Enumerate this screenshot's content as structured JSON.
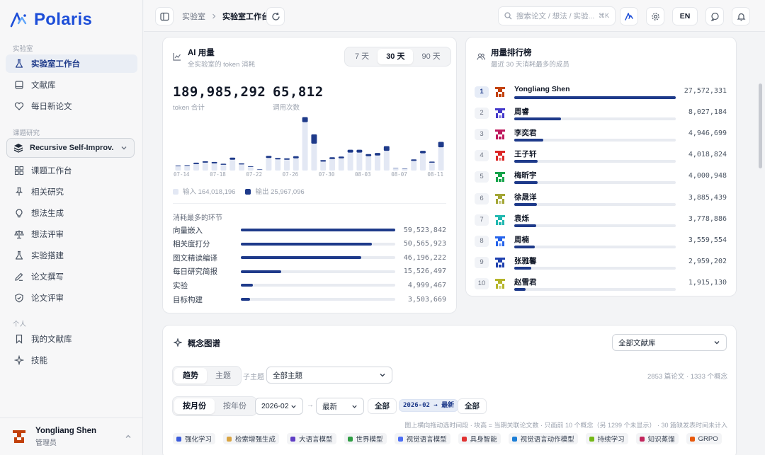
{
  "app": {
    "name": "Polaris"
  },
  "sidebar": {
    "section_lab": "实验室",
    "lab_items": [
      {
        "label": "实验室工作台",
        "icon": "flask-icon",
        "active": true
      },
      {
        "label": "文献库",
        "icon": "book-icon"
      },
      {
        "label": "每日新论文",
        "icon": "heart-icon"
      }
    ],
    "section_topic": "课题研究",
    "project": "Recursive Self-Improv...",
    "topic_items": [
      {
        "label": "课题工作台",
        "icon": "grid-icon"
      },
      {
        "label": "相关研究",
        "icon": "pin-icon"
      },
      {
        "label": "想法生成",
        "icon": "bulb-icon"
      },
      {
        "label": "想法评审",
        "icon": "scale-icon"
      },
      {
        "label": "实验搭建",
        "icon": "flask-icon"
      },
      {
        "label": "论文撰写",
        "icon": "pen-icon"
      },
      {
        "label": "论文评审",
        "icon": "shield-icon"
      }
    ],
    "section_personal": "个人",
    "personal_items": [
      {
        "label": "我的文献库",
        "icon": "bookmark-icon"
      },
      {
        "label": "技能",
        "icon": "sparkle-icon"
      }
    ],
    "user": {
      "name": "Yongliang Shen",
      "role": "管理员"
    }
  },
  "topbar": {
    "breadcrumb": [
      "实验室",
      "实验室工作台"
    ],
    "search_placeholder": "搜索论文 / 想法 / 实验...",
    "search_shortcut": "⌘K",
    "lang": "EN"
  },
  "usage": {
    "title": "AI 用量",
    "subtitle": "全实验室的 token 消耗",
    "ranges": [
      "7 天",
      "30 天",
      "90 天"
    ],
    "active_range": "30 天",
    "total_tokens": "189,985,292",
    "total_tokens_label": "token 合计",
    "calls": "65,812",
    "calls_label": "调用次数",
    "legend_input": "输入 164,018,196",
    "legend_output": "输出 25,967,096",
    "colors": {
      "input": "#e3e8f4",
      "output": "#1e3a8a"
    },
    "stages_title": "消耗最多的环节",
    "stages": [
      {
        "label": "向量嵌入",
        "value": "59,523,842",
        "frac": 1.0
      },
      {
        "label": "相关度打分",
        "value": "50,565,923",
        "frac": 0.85
      },
      {
        "label": "图文精读编译",
        "value": "46,196,222",
        "frac": 0.78
      },
      {
        "label": "每日研究简报",
        "value": "15,526,497",
        "frac": 0.26
      },
      {
        "label": "实验",
        "value": "4,999,467",
        "frac": 0.08
      },
      {
        "label": "目标构建",
        "value": "3,503,669",
        "frac": 0.06
      }
    ]
  },
  "chart_data": {
    "type": "bar",
    "categories": [
      "07-14",
      "07-15",
      "07-16",
      "07-17",
      "07-18",
      "07-19",
      "07-20",
      "07-21",
      "07-22",
      "07-23",
      "07-24",
      "07-25",
      "07-26",
      "07-27",
      "07-28",
      "07-29",
      "07-30",
      "07-31",
      "08-01",
      "08-02",
      "08-03",
      "08-04",
      "08-05",
      "08-06",
      "08-07",
      "08-08",
      "08-09",
      "08-10",
      "08-11",
      "08-12"
    ],
    "tick_labels": [
      "07-14",
      "07-18",
      "07-22",
      "07-26",
      "07-30",
      "08-03",
      "08-07",
      "08-11"
    ],
    "series": [
      {
        "name": "输入",
        "values": [
          1.2,
          1.3,
          1.8,
          2.2,
          2.0,
          1.6,
          3.0,
          1.7,
          1.0,
          0.3,
          3.5,
          3.1,
          3.0,
          3.4,
          13.5,
          7.5,
          2.5,
          3.2,
          3.4,
          5.0,
          5.0,
          4.0,
          4.2,
          5.5,
          0.6,
          0.5,
          2.7,
          4.8,
          2.2,
          6.5
        ]
      },
      {
        "name": "输出",
        "values": [
          0.2,
          0.2,
          0.4,
          0.4,
          0.4,
          0.3,
          0.6,
          0.3,
          0.2,
          0.1,
          0.6,
          0.4,
          0.4,
          0.6,
          1.4,
          2.6,
          0.4,
          0.5,
          0.5,
          0.8,
          0.8,
          0.6,
          0.7,
          1.3,
          0.1,
          0.1,
          0.4,
          0.7,
          0.3,
          1.5
        ]
      }
    ]
  },
  "ranking": {
    "title": "用量排行榜",
    "subtitle": "最近 30 天消耗最多的成员",
    "rows": [
      {
        "rank": "1",
        "name": "Yongliang Shen",
        "value": "27,572,331",
        "frac": 1.0,
        "color": "#c2410c"
      },
      {
        "rank": "2",
        "name": "周睿",
        "value": "8,027,184",
        "frac": 0.29,
        "color": "#4338ca"
      },
      {
        "rank": "3",
        "name": "李奕君",
        "value": "4,946,699",
        "frac": 0.18,
        "color": "#be185d"
      },
      {
        "rank": "4",
        "name": "王子轩",
        "value": "4,018,824",
        "frac": 0.146,
        "color": "#dc2626"
      },
      {
        "rank": "5",
        "name": "梅昕宇",
        "value": "4,000,948",
        "frac": 0.145,
        "color": "#16a34a"
      },
      {
        "rank": "6",
        "name": "徐晟洋",
        "value": "3,885,439",
        "frac": 0.141,
        "color": "#a3a635"
      },
      {
        "rank": "7",
        "name": "袁烁",
        "value": "3,778,886",
        "frac": 0.137,
        "color": "#22b8b0"
      },
      {
        "rank": "8",
        "name": "周楠",
        "value": "3,559,554",
        "frac": 0.129,
        "color": "#2563eb"
      },
      {
        "rank": "9",
        "name": "张雅馨",
        "value": "2,959,202",
        "frac": 0.107,
        "color": "#1e40af"
      },
      {
        "rank": "10",
        "name": "赵雪君",
        "value": "1,915,130",
        "frac": 0.069,
        "color": "#b5b52a"
      }
    ]
  },
  "concept": {
    "title": "概念图谱",
    "library_select": "全部文献库",
    "tabs": [
      "趋势",
      "主题"
    ],
    "subtopic_label": "子主题",
    "subtopic_select": "全部主题",
    "counts": "2853 篇论文 · 1333 个概念",
    "granularity": [
      "按月份",
      "按年份"
    ],
    "month_select": "2026-02",
    "arrow": "→",
    "to_select": "最新",
    "all1": "全部",
    "range_badge": "2026-02 → 最新",
    "all2": "全部",
    "hint": "图上横向拖动选时间段 · 块高 = 当期关联论文数 · 只画前 10 个概念（另 1299 个未显示） · 30 篇缺发表时间未计入",
    "tags": [
      {
        "label": "强化学习",
        "color": "#3b5bdb"
      },
      {
        "label": "检索增强生成",
        "color": "#d9a441"
      },
      {
        "label": "大语言模型",
        "color": "#5f3dc4"
      },
      {
        "label": "世界模型",
        "color": "#2f9e44"
      },
      {
        "label": "视觉语言模型",
        "color": "#4c6ef5"
      },
      {
        "label": "具身智能",
        "color": "#e03131"
      },
      {
        "label": "视觉语言动作模型",
        "color": "#1c7ed6"
      },
      {
        "label": "持续学习",
        "color": "#74b816"
      },
      {
        "label": "知识蒸馏",
        "color": "#c2255c"
      },
      {
        "label": "GRPO",
        "color": "#e8590c"
      }
    ]
  }
}
